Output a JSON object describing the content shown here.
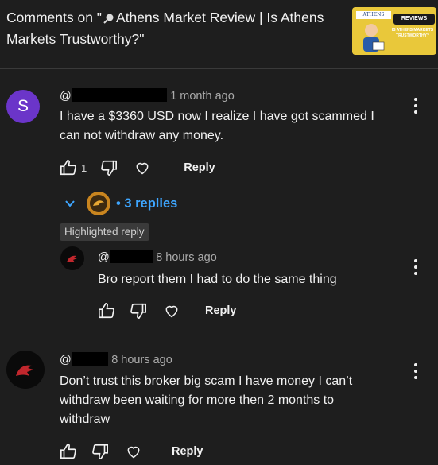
{
  "header": {
    "title_part1": "Comments on \"",
    "title_part2": "Athens Market Review | Is Athens Markets Trustworthy?\"",
    "thumbnail": {
      "logo_text": "ATHENS",
      "badge_text": "REVIEWS",
      "sub_text": "IS ATHENS MARKETS TRUSTWORTHY?"
    }
  },
  "comments": [
    {
      "handle": "@",
      "time": "1 month ago",
      "line1": "I have a $3360 USD now I realize I have got scammed I",
      "line2": "can not withdraw any money.",
      "likes": "1",
      "reply_label": "Reply",
      "avatar_letter": "S"
    },
    {
      "handle": "@",
      "time": "8 hours ago",
      "line1": "Don’t trust this broker big scam I have money I can’t",
      "line2": "withdraw been waiting for more then 2 months to",
      "line3": "withdraw",
      "reply_label": "Reply"
    }
  ],
  "replies_toggle": {
    "label": "• 3 replies"
  },
  "highlighted": {
    "tag": "Highlighted reply",
    "handle": "@",
    "time": "8 hours ago",
    "text": "Bro report them I had to do the same thing",
    "reply_label": "Reply"
  },
  "colors": {
    "background": "#1e1e1e",
    "link_blue": "#3ea6ff",
    "avatar_purple": "#6b35c9"
  }
}
